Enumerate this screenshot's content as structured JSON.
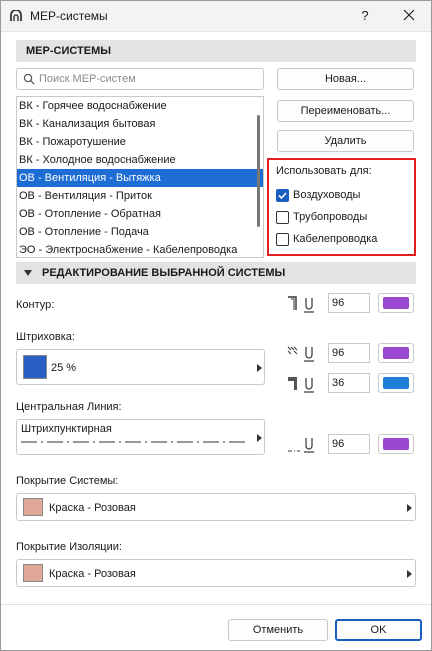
{
  "window": {
    "title": "MEP-системы",
    "help_label": "?"
  },
  "systems": {
    "section_title": "MEP-СИСТЕМЫ",
    "search_placeholder": "Поиск MEP-систем",
    "items": [
      {
        "label": "ВК - Горячее водоснабжение",
        "selected": false
      },
      {
        "label": "ВК - Канализация бытовая",
        "selected": false
      },
      {
        "label": "ВК - Пожаротушение",
        "selected": false
      },
      {
        "label": "ВК - Холодное водоснабжение",
        "selected": false
      },
      {
        "label": "ОВ - Вентиляция - Вытяжка",
        "selected": true
      },
      {
        "label": "ОВ - Вентиляция - Приток",
        "selected": false
      },
      {
        "label": "ОВ - Отопление - Обратная",
        "selected": false
      },
      {
        "label": "ОВ - Отопление - Подача",
        "selected": false
      },
      {
        "label": "ЭО - Электроснабжение - Кабелепроводка",
        "selected": false
      }
    ],
    "new_label": "Новая...",
    "rename_label": "Переименовать...",
    "delete_label": "Удалить",
    "use_for": {
      "title": "Использовать для:",
      "options": [
        {
          "label": "Воздуховоды",
          "checked": true
        },
        {
          "label": "Трубопроводы",
          "checked": false
        },
        {
          "label": "Кабелепроводка",
          "checked": false
        }
      ]
    }
  },
  "edit": {
    "section_title": "РЕДАКТИРОВАНИЕ ВЫБРАННОЙ СИСТЕМЫ",
    "contour": {
      "label": "Контур:",
      "pen": "96",
      "pen_color": "#9a48d0"
    },
    "hatch": {
      "label": "Штриховка:",
      "value": "25 %",
      "swatch_color": "#2a5fc6",
      "fg_pen": "96",
      "fg_color": "#9a48d0",
      "bg_pen": "36",
      "bg_color": "#1f7fd6"
    },
    "centerline": {
      "label": "Центральная Линия:",
      "value": "Штрихпунктирная",
      "pen": "96",
      "pen_color": "#9a48d0"
    },
    "system_cover": {
      "label": "Покрытие Системы:",
      "value": "Краска - Розовая",
      "swatch_color": "#e0a898"
    },
    "insulation_cover": {
      "label": "Покрытие Изоляции:",
      "value": "Краска - Розовая",
      "swatch_color": "#e0a898"
    }
  },
  "footer": {
    "cancel_label": "Отменить",
    "ok_label": "OK"
  },
  "colors": {
    "selection": "#1e6dd4",
    "highlight_border": "#e02020",
    "accent": "#1a5fbf"
  }
}
